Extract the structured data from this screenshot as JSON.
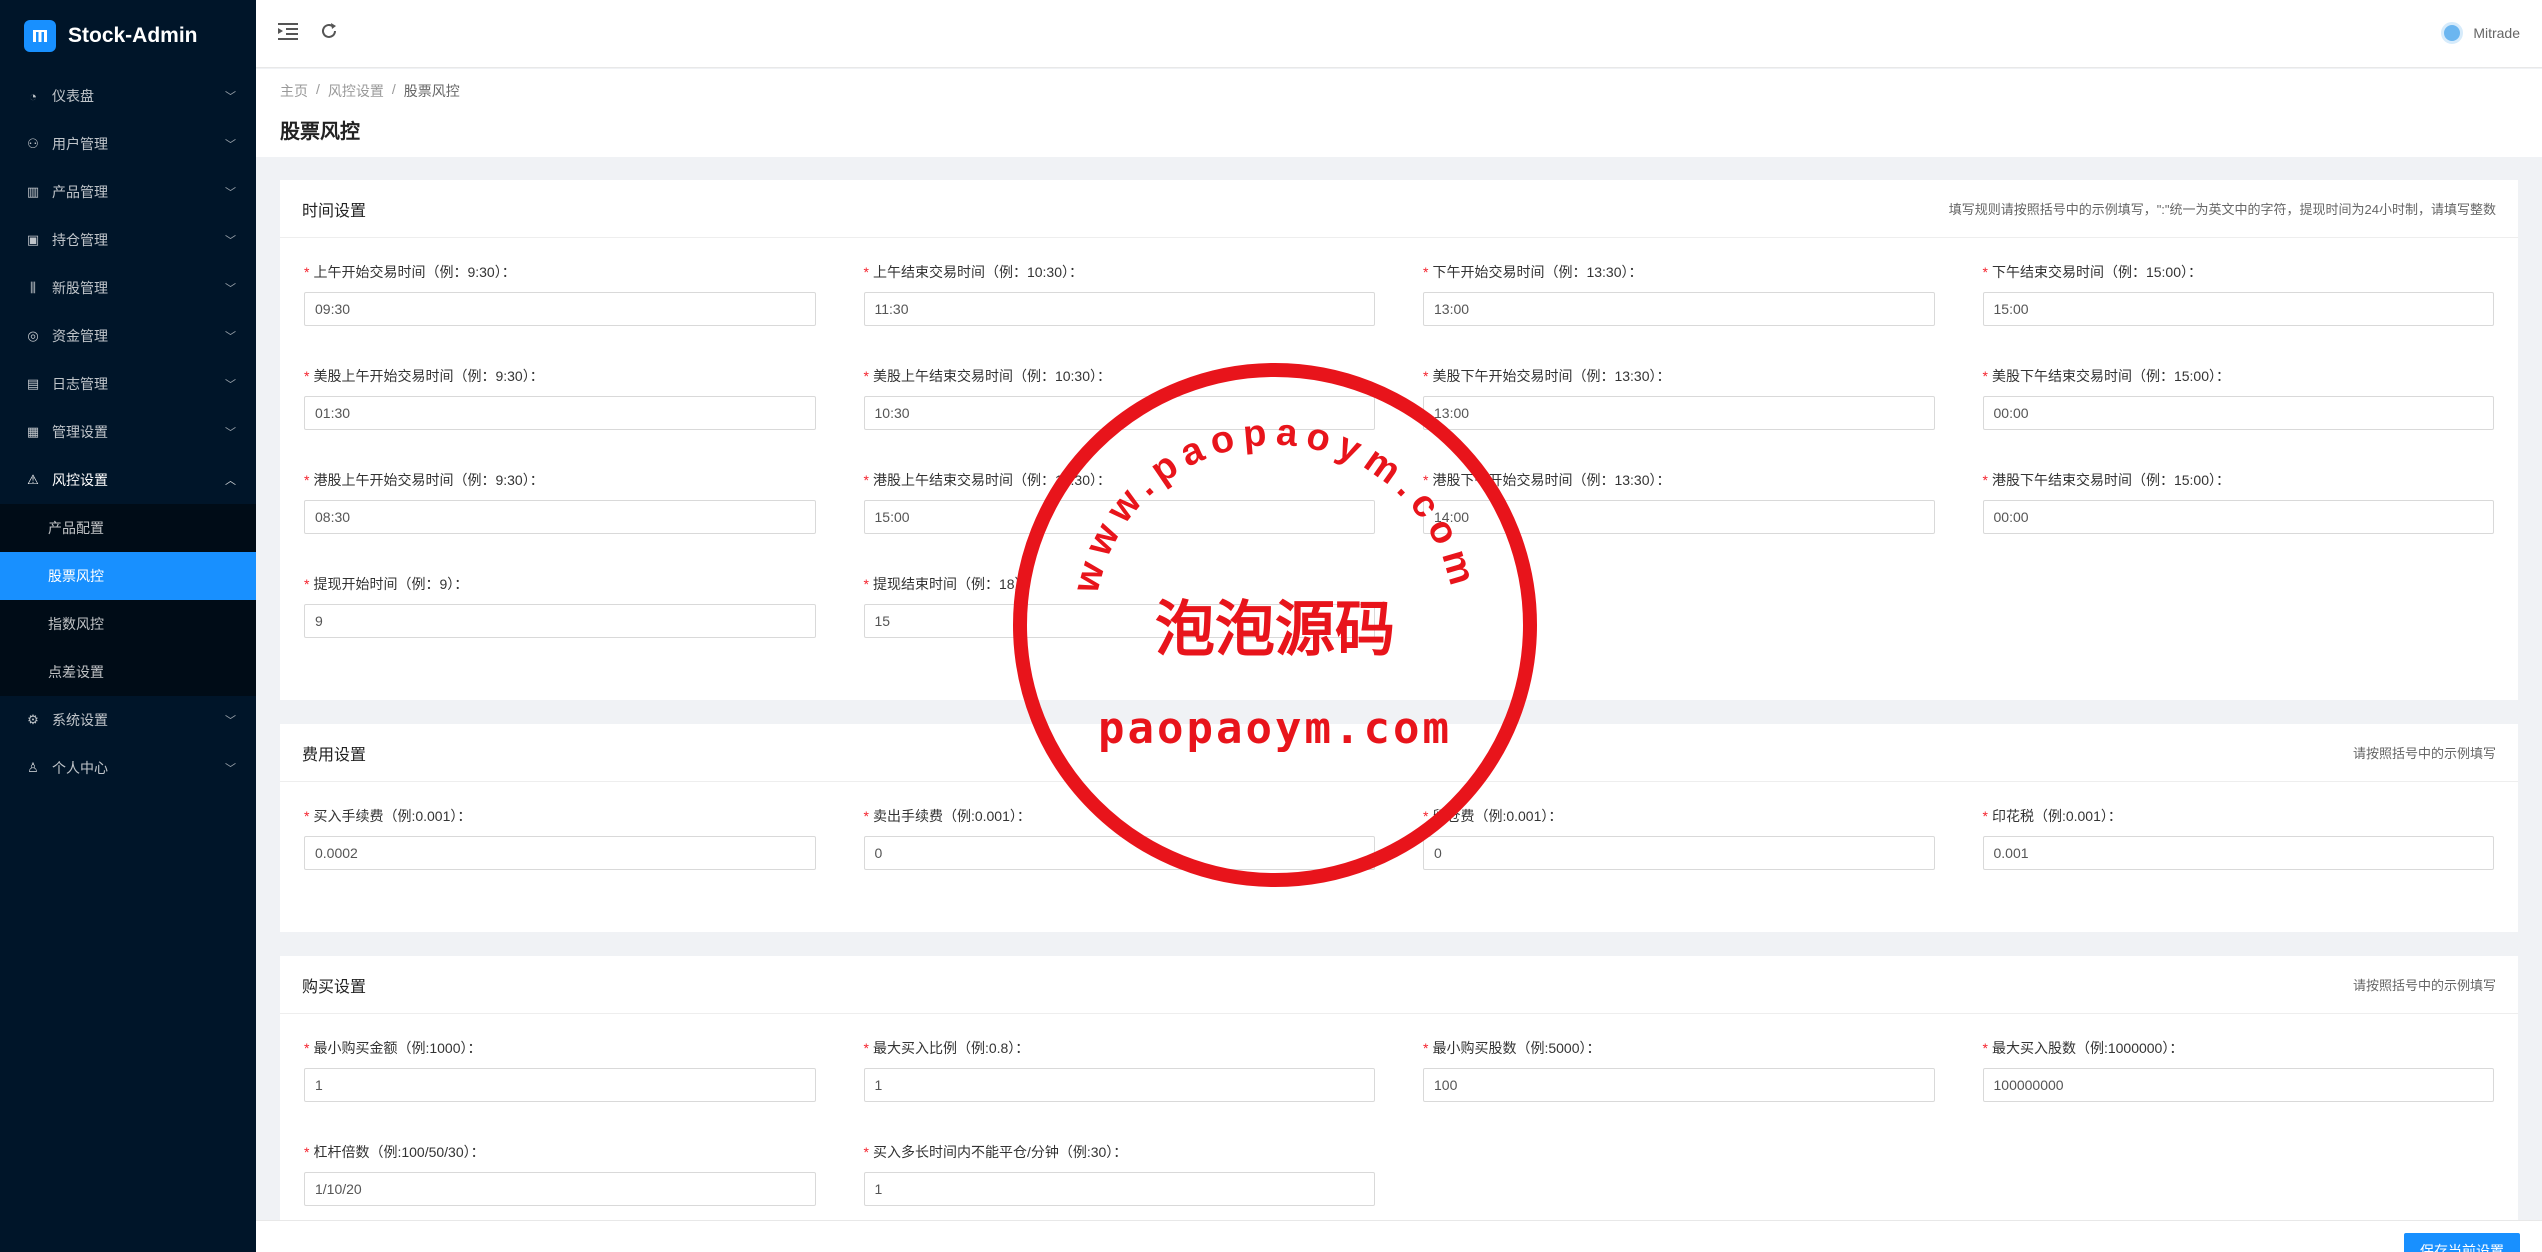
{
  "app": {
    "title": "Stock-Admin"
  },
  "sidebar": {
    "items": [
      {
        "label": "仪表盘",
        "icon": "dashboard-icon"
      },
      {
        "label": "用户管理",
        "icon": "user-manage-icon"
      },
      {
        "label": "产品管理",
        "icon": "chart-icon"
      },
      {
        "label": "持仓管理",
        "icon": "position-icon"
      },
      {
        "label": "新股管理",
        "icon": "new-stock-icon"
      },
      {
        "label": "资金管理",
        "icon": "money-icon"
      },
      {
        "label": "日志管理",
        "icon": "log-icon"
      },
      {
        "label": "管理设置",
        "icon": "settings-grid-icon"
      },
      {
        "label": "风控设置",
        "icon": "warning-icon",
        "open": true
      },
      {
        "label": "系统设置",
        "icon": "gear-icon"
      },
      {
        "label": "个人中心",
        "icon": "person-icon"
      }
    ],
    "sub_items": [
      {
        "label": "产品配置"
      },
      {
        "label": "股票风控",
        "active": true
      },
      {
        "label": "指数风控"
      },
      {
        "label": "点差设置"
      }
    ]
  },
  "header": {
    "user_name": "Mitrade"
  },
  "breadcrumb": [
    "主页",
    "风控设置",
    "股票风控"
  ],
  "page": {
    "title": "股票风控"
  },
  "cards": [
    {
      "title": "时间设置",
      "extra": "填写规则请按照括号中的示例填写，\":\"统一为英文中的字符，提现时间为24小时制，请填写整数",
      "fields": [
        {
          "label": "上午开始交易时间（例：9:30）：",
          "value": "09:30"
        },
        {
          "label": "上午结束交易时间（例：10:30）：",
          "value": "11:30"
        },
        {
          "label": "下午开始交易时间（例：13:30）：",
          "value": "13:00"
        },
        {
          "label": "下午结束交易时间（例：15:00）：",
          "value": "15:00"
        },
        {
          "label": "美股上午开始交易时间（例：9:30）：",
          "value": "01:30"
        },
        {
          "label": "美股上午结束交易时间（例：10:30）：",
          "value": "10:30"
        },
        {
          "label": "美股下午开始交易时间（例：13:30）：",
          "value": "13:00"
        },
        {
          "label": "美股下午结束交易时间（例：15:00）：",
          "value": "00:00"
        },
        {
          "label": "港股上午开始交易时间（例：9:30）：",
          "value": "08:30"
        },
        {
          "label": "港股上午结束交易时间（例：10:30）：",
          "value": "15:00"
        },
        {
          "label": "港股下午开始交易时间（例：13:30）：",
          "value": "14:00"
        },
        {
          "label": "港股下午结束交易时间（例：15:00）：",
          "value": "00:00"
        },
        {
          "label": "提现开始时间（例：9）：",
          "value": "9"
        },
        {
          "label": "提现结束时间（例：18）：",
          "value": "15"
        }
      ]
    },
    {
      "title": "费用设置",
      "extra": "请按照括号中的示例填写",
      "fields": [
        {
          "label": "买入手续费（例:0.001）：",
          "value": "0.0002"
        },
        {
          "label": "卖出手续费（例:0.001）：",
          "value": "0"
        },
        {
          "label": "留仓费（例:0.001）：",
          "value": "0"
        },
        {
          "label": "印花税（例:0.001）：",
          "value": "0.001"
        }
      ]
    },
    {
      "title": "购买设置",
      "extra": "请按照括号中的示例填写",
      "fields": [
        {
          "label": "最小购买金额（例:1000）：",
          "value": "1"
        },
        {
          "label": "最大买入比例（例:0.8）：",
          "value": "1"
        },
        {
          "label": "最小购买股数（例:5000）：",
          "value": "100"
        },
        {
          "label": "最大买入股数（例:1000000）：",
          "value": "100000000"
        },
        {
          "label": "杠杆倍数（例:100/50/30）：",
          "value": "1/10/20"
        },
        {
          "label": "买入多长时间内不能平仓/分钟（例:30）：",
          "value": "1"
        }
      ]
    }
  ],
  "footer": {
    "save_label": "保存当前设置"
  },
  "watermark": {
    "arc_text": "www.paopaoym.com",
    "center_text": "泡泡源码",
    "bottom_text": "paopaoym.com",
    "color": "#e8141b"
  },
  "colors": {
    "sidebar_bg": "#001529",
    "primary": "#1890ff",
    "required": "#f5222d"
  }
}
